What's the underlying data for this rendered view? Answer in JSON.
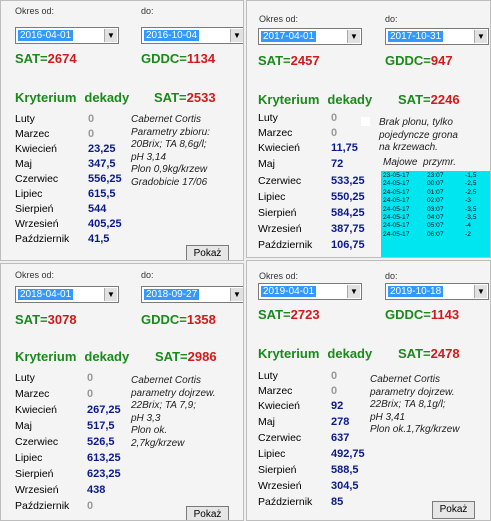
{
  "panels": [
    {
      "okres_od_label": "Okres od:",
      "do_label": "do:",
      "date_from": "2016-04-01",
      "date_to": "2016-10-04",
      "sat_label": "SAT=",
      "sat_value": "2674",
      "gddc_label": "GDDC=",
      "gddc_value": "1134",
      "kryterium": "Kryterium",
      "dekady": "dekady",
      "sat2_label": "SAT=",
      "sat2_value": "2533",
      "months": [
        {
          "name": "Luty",
          "value": "0"
        },
        {
          "name": "Marzec",
          "value": "0"
        },
        {
          "name": "Kwiecień",
          "value": "23,25"
        },
        {
          "name": "Maj",
          "value": "347,5"
        },
        {
          "name": "Czerwiec",
          "value": "556,25"
        },
        {
          "name": "Lipiec",
          "value": "615,5"
        },
        {
          "name": "Sierpień",
          "value": "544"
        },
        {
          "name": "Wrzesień",
          "value": "405,25"
        },
        {
          "name": "Październik",
          "value": "41,5"
        }
      ],
      "note": "Cabernet Cortis\nParametry zbioru:\n20Brix; TA 8,6g/l;\npH 3,14\nPlon 0,9kg/krzew\nGradobicie 17/06",
      "button": "Pokaż"
    },
    {
      "okres_od_label": "Okres od:",
      "do_label": "do:",
      "date_from": "2017-04-01",
      "date_to": "2017-10-31",
      "sat_label": "SAT=",
      "sat_value": "2457",
      "gddc_label": "GDDC=",
      "gddc_value": "947",
      "kryterium": "Kryterium",
      "dekady": "dekady",
      "sat2_label": "SAT=",
      "sat2_value": "2246",
      "months": [
        {
          "name": "Luty",
          "value": "0"
        },
        {
          "name": "Marzec",
          "value": "0"
        },
        {
          "name": "Kwiecień",
          "value": "11,75"
        },
        {
          "name": "Maj",
          "value": "72"
        },
        {
          "name": "Czerwiec",
          "value": "533,25"
        },
        {
          "name": "Lipiec",
          "value": "550,25"
        },
        {
          "name": "Sierpień",
          "value": "584,25"
        },
        {
          "name": "Wrzesień",
          "value": "387,75"
        },
        {
          "name": "Październik",
          "value": "106,75"
        }
      ],
      "note": "Brak plonu, tylko\npojedyncze grona\nna krzewach.",
      "frost_header": "Majowe  przymr.",
      "frost_rows": [
        [
          "23-05-17",
          "23:07",
          "-1,5"
        ],
        [
          "24-05-17",
          "00:07",
          "-2,5"
        ],
        [
          "24-05-17",
          "01:07",
          "-2,5"
        ],
        [
          "24-05-17",
          "02:07",
          "-3"
        ],
        [
          "24-05-17",
          "03:07",
          "-3,5"
        ],
        [
          "24-05-17",
          "04:07",
          "-3,5"
        ],
        [
          "24-05-17",
          "05:07",
          "-4"
        ],
        [
          "24-05-17",
          "06:07",
          "-2"
        ]
      ]
    },
    {
      "okres_od_label": "Okres od:",
      "do_label": "do:",
      "date_from": "2018-04-01",
      "date_to": "2018-09-27",
      "sat_label": "SAT=",
      "sat_value": "3078",
      "gddc_label": "GDDC=",
      "gddc_value": "1358",
      "kryterium": "Kryterium",
      "dekady": "dekady",
      "sat2_label": "SAT=",
      "sat2_value": "2986",
      "months": [
        {
          "name": "Luty",
          "value": "0"
        },
        {
          "name": "Marzec",
          "value": "0"
        },
        {
          "name": "Kwiecień",
          "value": "267,25"
        },
        {
          "name": "Maj",
          "value": "517,5"
        },
        {
          "name": "Czerwiec",
          "value": "526,5"
        },
        {
          "name": "Lipiec",
          "value": "613,25"
        },
        {
          "name": "Sierpień",
          "value": "623,25"
        },
        {
          "name": "Wrzesień",
          "value": "438"
        },
        {
          "name": "Październik",
          "value": "0"
        }
      ],
      "note": "Cabernet Cortis\nparametry dojrzew.\n22Brix; TA 7,9;\npH 3,3\nPlon ok.\n2,7kg/krzew",
      "button": "Pokaż"
    },
    {
      "okres_od_label": "Okres od:",
      "do_label": "do:",
      "date_from": "2019-04-01",
      "date_to": "2019-10-18",
      "sat_label": "SAT=",
      "sat_value": "2723",
      "gddc_label": "GDDC=",
      "gddc_value": "1143",
      "kryterium": "Kryterium",
      "dekady": "dekady",
      "sat2_label": "SAT=",
      "sat2_value": "2478",
      "months": [
        {
          "name": "Luty",
          "value": "0"
        },
        {
          "name": "Marzec",
          "value": "0"
        },
        {
          "name": "Kwiecień",
          "value": "92"
        },
        {
          "name": "Maj",
          "value": "278"
        },
        {
          "name": "Czerwiec",
          "value": "637"
        },
        {
          "name": "Lipiec",
          "value": "492,75"
        },
        {
          "name": "Sierpień",
          "value": "588,5"
        },
        {
          "name": "Wrzesień",
          "value": "304,5"
        },
        {
          "name": "Październik",
          "value": "85"
        }
      ],
      "note": "Cabernet Cortis\nparametry dojrzew.\n22Brix; TA 8,1g/l;\npH 3,41\nPlon ok.1,7kg/krzew",
      "button": "Pokaż"
    }
  ],
  "colors": {
    "green_label": "#1a8a1a",
    "red_value": "#d01b1b",
    "blue_value": "#0a1a8a",
    "selection": "#3399ff",
    "frost_bg": "#00e6f0"
  },
  "icons": {
    "dropdown": "chevron-down-icon"
  }
}
